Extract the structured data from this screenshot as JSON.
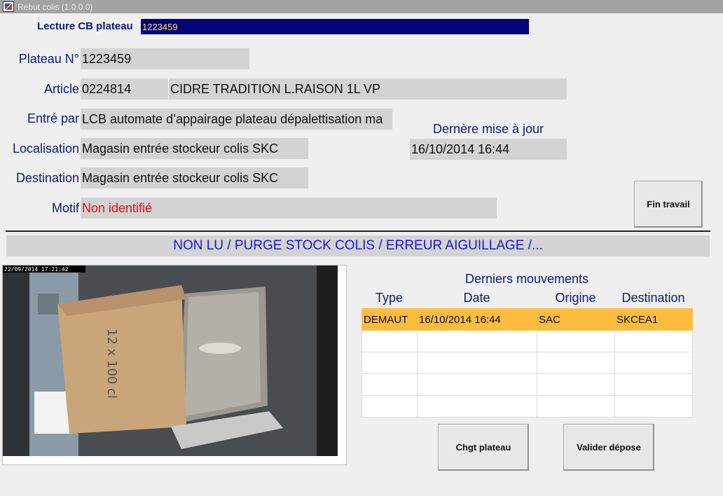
{
  "window": {
    "title": "Rebut colis (1.0.0.0)",
    "icon": "app-window-icon"
  },
  "barcode": {
    "label": "Lecture CB plateau",
    "value": "1223459"
  },
  "fields": {
    "plateau": {
      "label": "Plateau N°",
      "value": "1223459"
    },
    "article": {
      "label": "Article",
      "code": "0224814",
      "description": "CIDRE TRADITION L.RAISON 1L VP"
    },
    "entre_par": {
      "label": "Entré par",
      "value": "LCB automate d’appairage plateau dépalettisation ma"
    },
    "derniere_maj": {
      "label": "Dernère mise à jour",
      "value": "16/10/2014 16:44"
    },
    "localisation": {
      "label": "Localisation",
      "value": "Magasin entrée stockeur colis SKC"
    },
    "destination": {
      "label": "Destination",
      "value": "Magasin entrée stockeur colis SKC"
    },
    "motif": {
      "label": "Motif",
      "value": "Non identifié",
      "color": "#e01010"
    }
  },
  "buttons": {
    "fin_travail": "Fin travail",
    "chgt_plateau": "Chgt plateau",
    "valider_depose": "Valider dépose"
  },
  "status_banner": "NON LU / PURGE STOCK COLIS / ERREUR AIGUILLAGE /...",
  "camera": {
    "timestamp": "22/09/2014  17:21:42",
    "box_text": "12 x 100 cl"
  },
  "movements": {
    "title": "Derniers mouvements",
    "columns": [
      "Type",
      "Date",
      "Origine",
      "Destination"
    ],
    "rows": [
      [
        "DEMAUT",
        "16/10/2014 16:44",
        "SAC",
        "SKCEA1"
      ],
      [
        "",
        "",
        "",
        ""
      ],
      [
        "",
        "",
        "",
        ""
      ],
      [
        "",
        "",
        "",
        ""
      ],
      [
        "",
        "",
        "",
        ""
      ]
    ],
    "selected_row": 0,
    "selected_color": "#fcbd3f"
  }
}
